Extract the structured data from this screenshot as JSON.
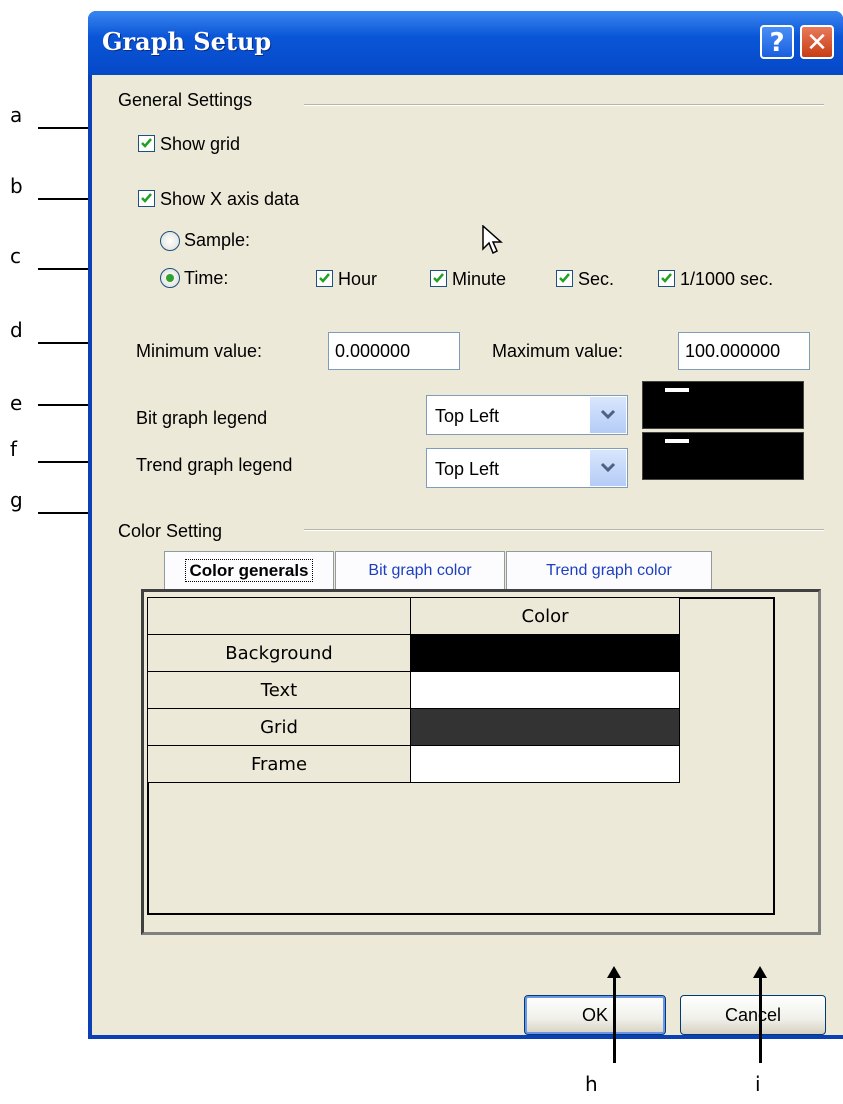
{
  "dialog": {
    "title": "Graph Setup",
    "help_glyph": "?",
    "close_glyph": "✕"
  },
  "general": {
    "group_label": "General Settings",
    "show_grid": {
      "label": "Show grid",
      "checked": true
    },
    "show_x_axis": {
      "label": "Show X axis data",
      "checked": true
    },
    "sample": {
      "label": "Sample:",
      "selected": false
    },
    "time": {
      "label": "Time:",
      "selected": true
    },
    "time_units": [
      {
        "label": "Hour",
        "checked": true
      },
      {
        "label": "Minute",
        "checked": true
      },
      {
        "label": "Sec.",
        "checked": true
      },
      {
        "label": "1/1000 sec.",
        "checked": true
      }
    ],
    "min_label": "Minimum value:",
    "min_value": "0.000000",
    "max_label": "Maximum value:",
    "max_value": "100.000000",
    "bit_legend_label": "Bit graph legend",
    "bit_legend_value": "Top Left",
    "trend_legend_label": "Trend graph legend",
    "trend_legend_value": "Top Left"
  },
  "color": {
    "group_label": "Color Setting",
    "tabs": [
      "Color generals",
      "Bit graph color",
      "Trend graph color"
    ],
    "active_tab": "Color generals",
    "column_header": "Color",
    "rows": [
      {
        "name": "Background",
        "color": "#000000"
      },
      {
        "name": "Text",
        "color": "#ffffff"
      },
      {
        "name": "Grid",
        "color": "#333333"
      },
      {
        "name": "Frame",
        "color": "#ffffff"
      }
    ]
  },
  "buttons": {
    "ok": "OK",
    "cancel": "Cancel"
  },
  "annotations": {
    "a": "a",
    "b": "b",
    "c": "c",
    "d": "d",
    "e": "e",
    "f": "f",
    "g": "g",
    "h": "h",
    "i": "i"
  }
}
